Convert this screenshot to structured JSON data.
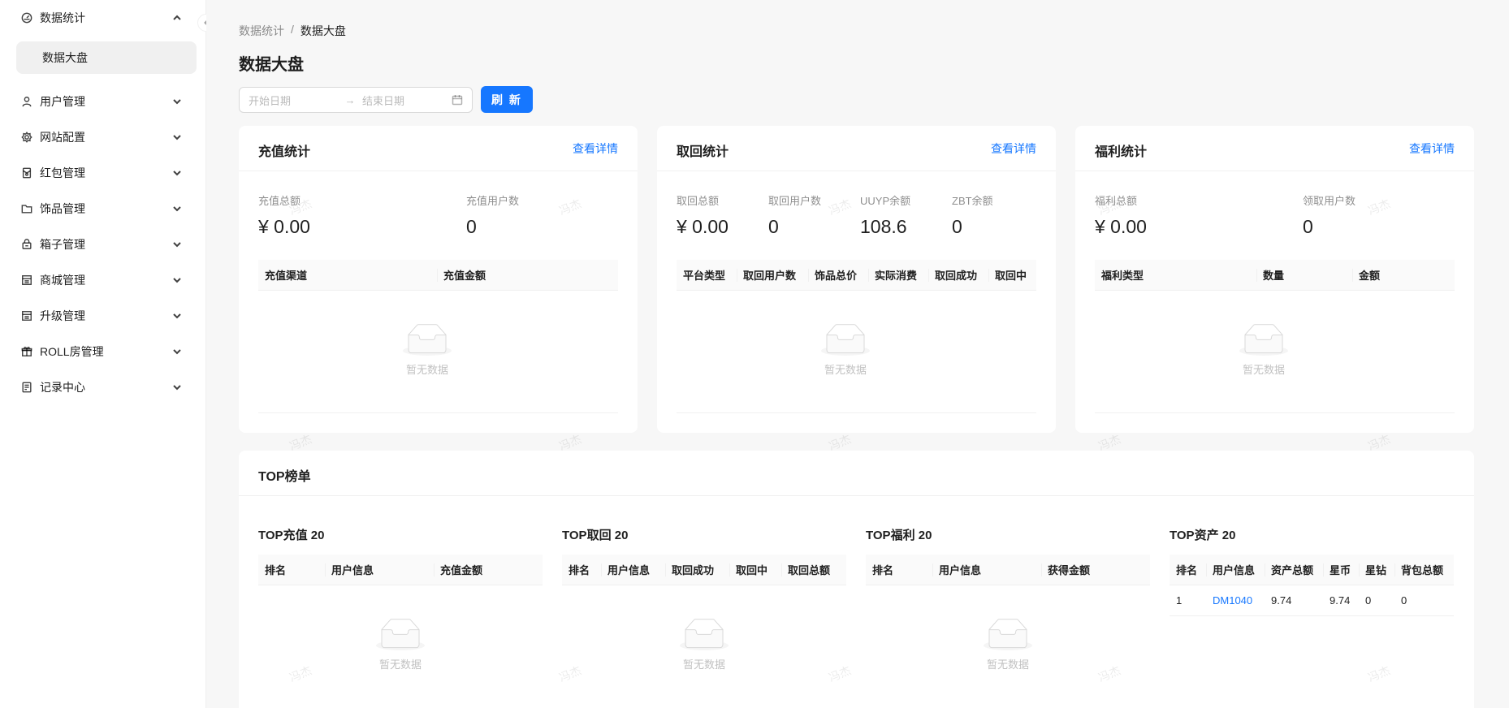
{
  "sidebar": {
    "collapse_icon": "chevron-left-icon",
    "items": [
      {
        "label": "数据统计",
        "icon": "dashboard-icon",
        "expanded": true
      },
      {
        "label": "用户管理",
        "icon": "user-icon"
      },
      {
        "label": "网站配置",
        "icon": "gear-icon"
      },
      {
        "label": "红包管理",
        "icon": "red-envelope-icon"
      },
      {
        "label": "饰品管理",
        "icon": "folder-icon"
      },
      {
        "label": "箱子管理",
        "icon": "box-icon"
      },
      {
        "label": "商城管理",
        "icon": "shop-icon"
      },
      {
        "label": "升级管理",
        "icon": "upgrade-icon"
      },
      {
        "label": "ROLL房管理",
        "icon": "gift-icon"
      },
      {
        "label": "记录中心",
        "icon": "record-icon"
      }
    ],
    "sub_items": [
      {
        "label": "数据大盘"
      }
    ]
  },
  "breadcrumb": [
    "数据统计",
    "/",
    "数据大盘"
  ],
  "page_title": "数据大盘",
  "range": {
    "start_placeholder": "开始日期",
    "separator": "→",
    "end_placeholder": "结束日期"
  },
  "refresh_label": "刷 新",
  "cards": [
    {
      "title": "充值统计",
      "extra": "查看详情",
      "stats": [
        {
          "label": "充值总额",
          "value": "¥ 0.00"
        },
        {
          "label": "充值用户数",
          "value": "0"
        }
      ],
      "columns": [
        "充值渠道",
        "充值金额"
      ],
      "empty": "暂无数据"
    },
    {
      "title": "取回统计",
      "extra": "查看详情",
      "stats": [
        {
          "label": "取回总额",
          "value": "¥ 0.00"
        },
        {
          "label": "取回用户数",
          "value": "0"
        },
        {
          "label": "UUYP余额",
          "value": "108.6"
        },
        {
          "label": "ZBT余额",
          "value": "0"
        }
      ],
      "columns": [
        "平台类型",
        "取回用户数",
        "饰品总价",
        "实际消费",
        "取回成功",
        "取回中"
      ],
      "empty": "暂无数据"
    },
    {
      "title": "福利统计",
      "extra": "查看详情",
      "stats": [
        {
          "label": "福利总额",
          "value": "¥ 0.00"
        },
        {
          "label": "领取用户数",
          "value": "0"
        }
      ],
      "columns": [
        "福利类型",
        "数量",
        "金额"
      ],
      "empty": "暂无数据"
    }
  ],
  "top": {
    "title": "TOP榜单",
    "boards": [
      {
        "title": "TOP充值 20",
        "columns": [
          "排名",
          "用户信息",
          "充值金额"
        ],
        "rows": [],
        "empty": "暂无数据"
      },
      {
        "title": "TOP取回 20",
        "columns": [
          "排名",
          "用户信息",
          "取回成功",
          "取回中",
          "取回总额"
        ],
        "rows": [],
        "empty": "暂无数据"
      },
      {
        "title": "TOP福利 20",
        "columns": [
          "排名",
          "用户信息",
          "获得金额"
        ],
        "rows": [],
        "empty": "暂无数据"
      },
      {
        "title": "TOP资产 20",
        "columns": [
          "排名",
          "用户信息",
          "资产总额",
          "星币",
          "星钻",
          "背包总额"
        ],
        "rows": [
          [
            "1",
            "DM1040",
            "9.74",
            "9.74",
            "0",
            "0"
          ]
        ]
      }
    ]
  },
  "watermark": "冯杰",
  "colors": {
    "primary": "#1677ff",
    "background": "#f7f7f7"
  }
}
